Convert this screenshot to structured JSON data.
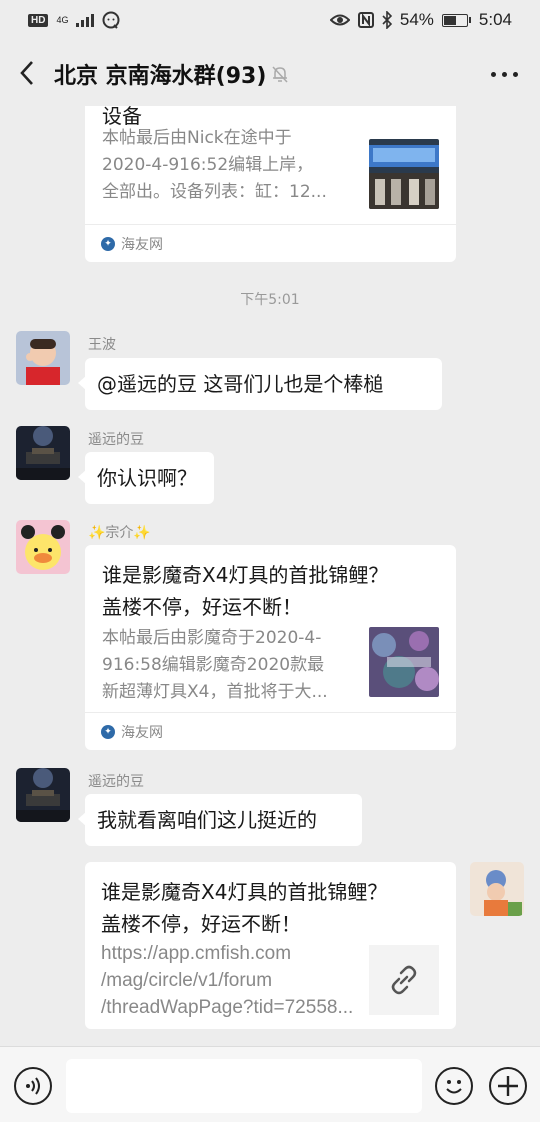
{
  "status_bar": {
    "hd": "HD",
    "network": "4G",
    "battery_percent": "54%",
    "battery_level": 0.54,
    "time": "5:04"
  },
  "header": {
    "title": "北京 京南海水群(93)",
    "icons": [
      "back-arrow-icon",
      "mute-bell-icon",
      "more-icon"
    ]
  },
  "messages": {
    "card1": {
      "title": "设备",
      "desc": [
        "本帖最后由Nick在途中于",
        "2020-4-916:52编辑上岸，",
        "全部出。设备列表：缸：12..."
      ],
      "source": "海友网"
    },
    "time_divider": "下午5:01",
    "msg1": {
      "sender": "王波",
      "text": "@遥远的豆  这哥们儿也是个棒槌"
    },
    "msg2": {
      "sender": "遥远的豆",
      "text": "你认识啊？"
    },
    "card2": {
      "sender": "✨宗介✨",
      "title": [
        "谁是影魔奇X4灯具的首批锦鲤？",
        "盖楼不停，好运不断！"
      ],
      "desc": [
        "本帖最后由影魔奇于2020-4-",
        "916:58编辑影魔奇2020款最",
        "新超薄灯具X4，首批将于大..."
      ],
      "source": "海友网"
    },
    "msg3": {
      "sender": "遥远的豆",
      "text": "我就看离咱们这儿挺近的"
    },
    "card3": {
      "title": [
        "谁是影魔奇X4灯具的首批锦鲤？",
        "盖楼不停，好运不断！"
      ],
      "link": [
        "https://app.cmfish.com",
        "/mag/circle/v1/forum",
        "/threadWapPage?tid=72558..."
      ]
    }
  },
  "input_bar": {
    "placeholder": "",
    "icons": [
      "voice-icon",
      "emoji-icon",
      "plus-icon"
    ]
  }
}
